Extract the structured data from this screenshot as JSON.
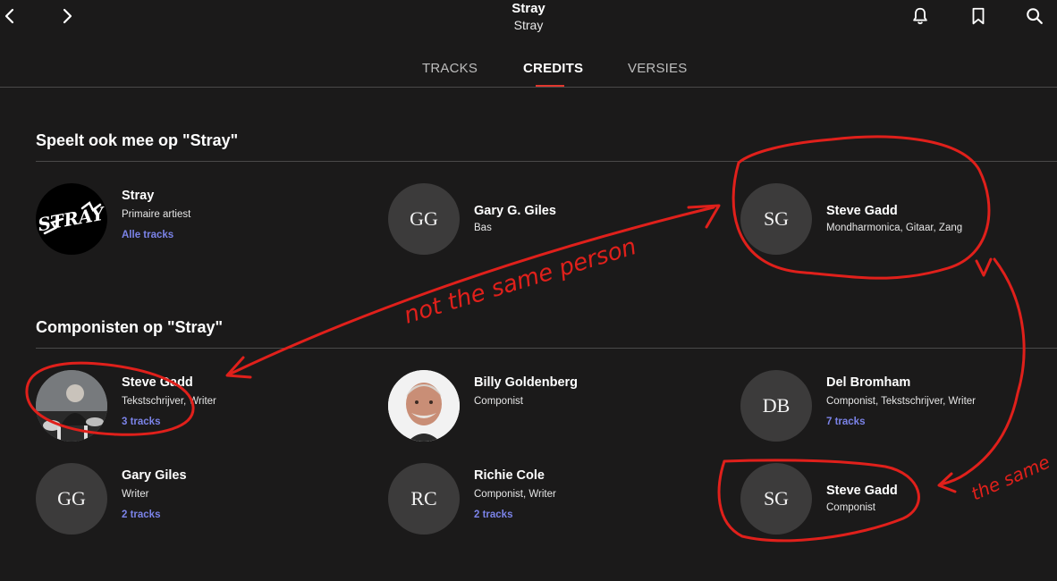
{
  "header": {
    "title": "Stray",
    "subtitle": "Stray",
    "icons": [
      "back-icon",
      "forward-icon",
      "bell-icon",
      "bookmark-icon",
      "search-icon"
    ]
  },
  "tabs": [
    {
      "label": "TRACKS"
    },
    {
      "label": "CREDITS",
      "active": true
    },
    {
      "label": "VERSIES"
    }
  ],
  "performers": {
    "title": "Speelt ook mee op \"Stray\"",
    "cards": [
      {
        "name": "Stray",
        "role": "Primaire artiest",
        "link": "Alle tracks",
        "avatar_text": "STRAY",
        "avatar_type": "logo"
      },
      {
        "name": "Gary G. Giles",
        "role": "Bas",
        "avatar_text": "GG"
      },
      {
        "name": "Steve Gadd",
        "role": "Mondharmonica, Gitaar, Zang",
        "avatar_text": "SG"
      }
    ]
  },
  "composers": {
    "title": "Componisten op \"Stray\"",
    "cards": [
      {
        "name": "Steve Gadd",
        "role": "Tekstschrijver, Writer",
        "link": "3 tracks",
        "avatar_type": "photo"
      },
      {
        "name": "Billy Goldenberg",
        "role": "Componist",
        "avatar_type": "photo"
      },
      {
        "name": "Del Bromham",
        "role": "Componist, Tekstschrijver, Writer",
        "link": "7 tracks",
        "avatar_text": "DB"
      },
      {
        "name": "Gary Giles",
        "role": "Writer",
        "link": "2 tracks",
        "avatar_text": "GG"
      },
      {
        "name": "Richie Cole",
        "role": "Componist, Writer",
        "link": "2 tracks",
        "avatar_text": "RC"
      },
      {
        "name": "Steve Gadd",
        "role": "Componist",
        "avatar_text": "SG"
      }
    ]
  },
  "annotations": {
    "color": "#e0201b",
    "arrow_text": "not the same person",
    "same_text": "the same"
  },
  "colors": {
    "background": "#1b1a1a",
    "accent": "#e1372e",
    "link": "#7b83e8",
    "avatar": "#3c3b3b"
  }
}
